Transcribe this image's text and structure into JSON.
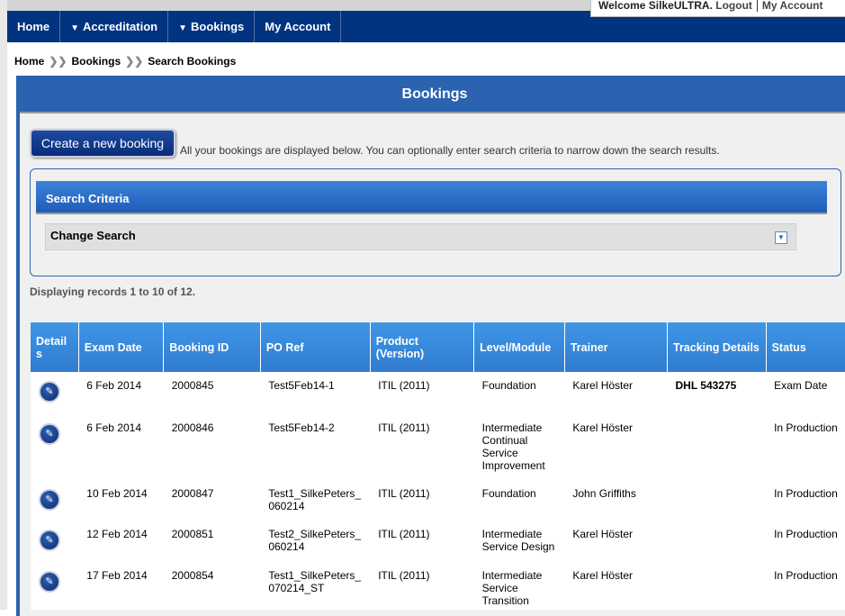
{
  "header": {
    "welcome": "Welcome SilkeULTRA.",
    "logout": "Logout",
    "my_account": "My Account"
  },
  "nav": [
    {
      "label": "Home",
      "dropdown": false
    },
    {
      "label": "Accreditation",
      "dropdown": true
    },
    {
      "label": "Bookings",
      "dropdown": true
    },
    {
      "label": "My Account",
      "dropdown": false
    }
  ],
  "breadcrumb": [
    "Home",
    "Bookings",
    "Search Bookings"
  ],
  "panel": {
    "title": "Bookings",
    "create_button": "Create a new booking",
    "intro": "All your bookings are displayed below. You can optionally enter search criteria to narrow down the search results."
  },
  "search": {
    "title": "Search Criteria",
    "change_label": "Change Search"
  },
  "records_text": "Displaying records 1 to 10 of 12.",
  "table": {
    "columns": [
      "Detail s",
      "Exam Date",
      "Booking ID",
      "PO Ref",
      "Product (Version)",
      "Level/Module",
      "Trainer",
      "Tracking Details",
      "Status"
    ],
    "rows": [
      {
        "date": "6 Feb 2014",
        "id": "2000845",
        "po": "Test5Feb14-1",
        "product": "ITIL (2011)",
        "level": "Foundation",
        "trainer": "Karel Höster",
        "tracking": "DHL 543275",
        "status": "Exam Date"
      },
      {
        "date": "6 Feb 2014",
        "id": "2000846",
        "po": "Test5Feb14-2",
        "product": "ITIL (2011)",
        "level": "Intermediate Continual Service Improvement",
        "trainer": "Karel Höster",
        "tracking": "",
        "status": "In Production"
      },
      {
        "date": "10 Feb 2014",
        "id": "2000847",
        "po": "Test1_SilkePeters_ 060214",
        "product": "ITIL (2011)",
        "level": "Foundation",
        "trainer": "John Griffiths",
        "tracking": "",
        "status": "In Production"
      },
      {
        "date": "12 Feb 2014",
        "id": "2000851",
        "po": "Test2_SilkePeters_ 060214",
        "product": "ITIL (2011)",
        "level": "Intermediate Service Design",
        "trainer": "Karel Höster",
        "tracking": "",
        "status": "In Production"
      },
      {
        "date": "17 Feb 2014",
        "id": "2000854",
        "po": "Test1_SilkePeters_ 070214_ST",
        "product": "ITIL (2011)",
        "level": "Intermediate Service Transition",
        "trainer": "Karel Höster",
        "tracking": "",
        "status": "In Production"
      }
    ]
  }
}
